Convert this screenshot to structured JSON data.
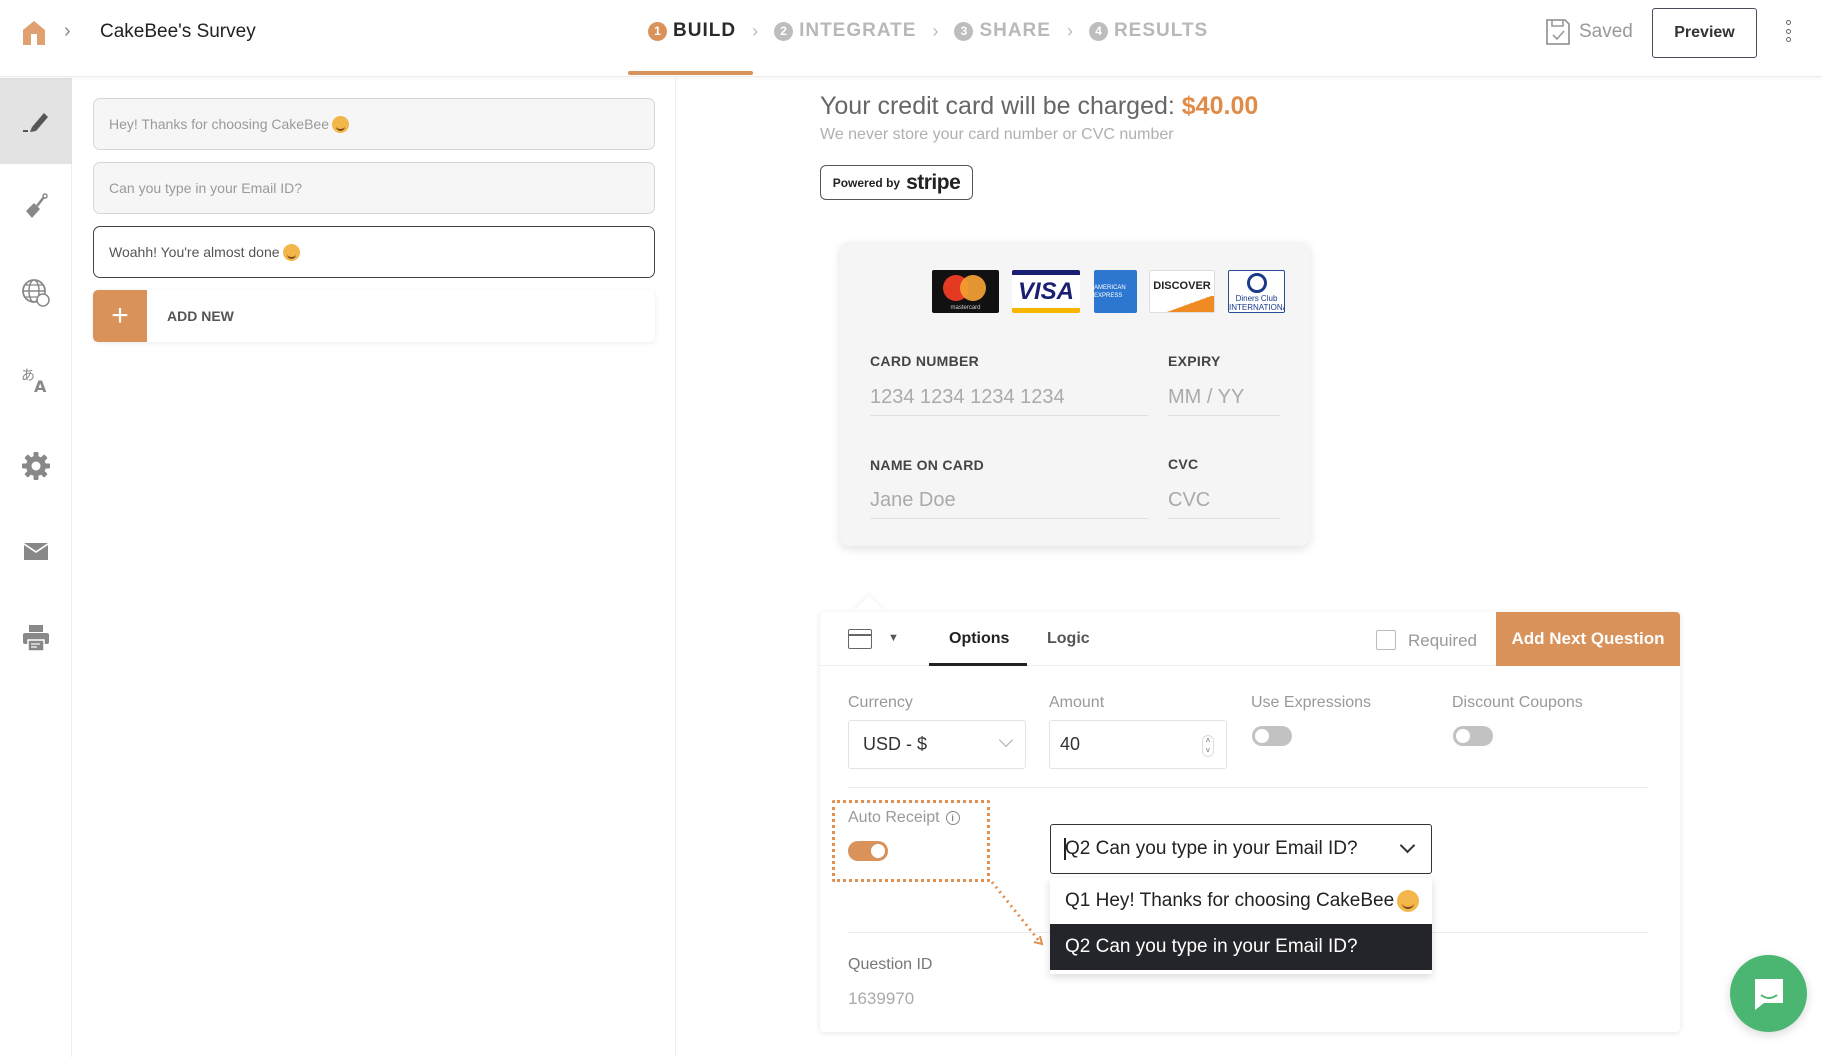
{
  "header": {
    "breadcrumb_title": "CakeBee's Survey",
    "steps": [
      {
        "num": "1",
        "label": "BUILD",
        "active": true
      },
      {
        "num": "2",
        "label": "INTEGRATE",
        "active": false
      },
      {
        "num": "3",
        "label": "SHARE",
        "active": false
      },
      {
        "num": "4",
        "label": "RESULTS",
        "active": false
      }
    ],
    "saved_label": "Saved",
    "preview_label": "Preview"
  },
  "sidebar": {
    "items": [
      {
        "icon": "pencil-icon",
        "active": true
      },
      {
        "icon": "paint-brush-icon"
      },
      {
        "icon": "globe-icon"
      },
      {
        "icon": "translate-icon"
      },
      {
        "icon": "gear-icon"
      },
      {
        "icon": "mail-icon"
      },
      {
        "icon": "printer-icon"
      }
    ]
  },
  "questions": {
    "items": [
      {
        "text": "Hey! Thanks for choosing CakeBee",
        "emoji": true
      },
      {
        "text": "Can you type in your Email ID?",
        "emoji": false
      },
      {
        "text": "Woahh! You're almost done ",
        "emoji": true,
        "selected": true
      }
    ],
    "add_new_label": "ADD NEW"
  },
  "payment": {
    "charge_text": "Your credit card will be charged: ",
    "charge_amount": "$40.00",
    "subtext": "We never store your card number or CVC number",
    "powered_by": "Powered by",
    "stripe": "stripe",
    "brands": [
      "mastercard",
      "VISA",
      "AMERICAN EXPRESS",
      "DISCOVER",
      "Diners Club INTERNATIONAL"
    ],
    "fields": {
      "card_number_label": "CARD NUMBER",
      "card_number_placeholder": "1234 1234 1234 1234",
      "expiry_label": "EXPIRY",
      "expiry_placeholder": "MM / YY",
      "name_label": "NAME ON CARD",
      "name_placeholder": "Jane Doe",
      "cvc_label": "CVC",
      "cvc_placeholder": "CVC"
    }
  },
  "options_panel": {
    "tabs": [
      {
        "label": "Options",
        "active": true
      },
      {
        "label": "Logic",
        "active": false
      }
    ],
    "required_label": "Required",
    "required_checked": false,
    "add_next_label": "Add Next Question",
    "currency_label": "Currency",
    "currency_value": "USD - $",
    "amount_label": "Amount",
    "amount_value": "40",
    "use_expressions_label": "Use Expressions",
    "use_expressions_on": false,
    "discount_coupons_label": "Discount Coupons",
    "discount_coupons_on": false,
    "auto_receipt_label": "Auto Receipt",
    "auto_receipt_on": true,
    "email_question_value": "Q2 Can you type in your Email ID?",
    "email_question_options": [
      {
        "label": "Q1 Hey! Thanks for choosing CakeBee",
        "emoji": true,
        "highlighted": false
      },
      {
        "label": "Q2 Can you type in your Email ID?",
        "emoji": false,
        "highlighted": true
      }
    ],
    "question_id_label": "Question ID",
    "question_id_value": "1639970"
  },
  "colors": {
    "accent": "#d8925a",
    "chat": "#4bb572",
    "highlight_row": "#24252b"
  }
}
